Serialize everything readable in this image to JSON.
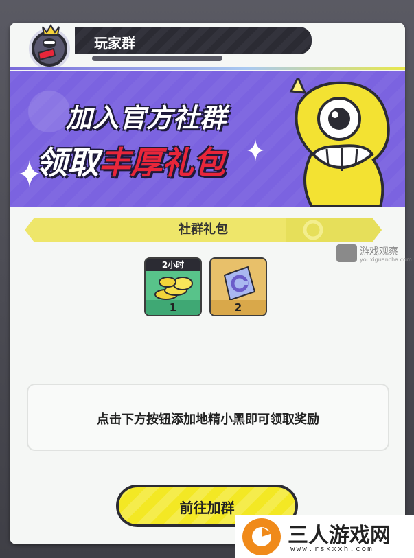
{
  "header": {
    "title": "玩家群"
  },
  "banner": {
    "line1": "加入官方社群",
    "line2_white": "领取",
    "line2_red": "丰厚礼包"
  },
  "section": {
    "title": "社群礼包"
  },
  "rewards": [
    {
      "tag": "2小时",
      "count": "1",
      "icon": "gold-coins-icon"
    },
    {
      "tag": "",
      "count": "2",
      "icon": "ticket-icon"
    }
  ],
  "message": "点击下方按钮添加地精小黑即可领取奖励",
  "join_button": "前往加群",
  "watermark": {
    "name": "游戏观察",
    "url": "youxiguancha.com"
  },
  "site_logo": {
    "name": "三人游戏网",
    "url": "www.rskxxh.com"
  },
  "colors": {
    "banner_bg": "#7b63e0",
    "accent_yellow": "#f3e824",
    "accent_red": "#e8263a",
    "dark": "#2b2b33"
  }
}
